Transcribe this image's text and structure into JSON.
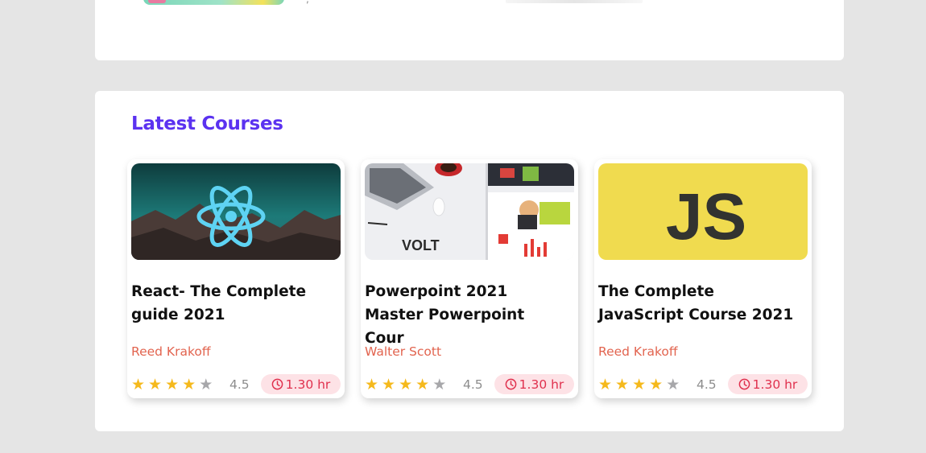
{
  "top": {
    "trailing_text": ","
  },
  "latest": {
    "title": "Latest Courses",
    "courses": [
      {
        "title": "React- The Complete guide 2021",
        "author": "Reed Krakoff",
        "rating": "4.5",
        "stars_filled": 4,
        "duration": "1.30 hr",
        "thumbnail": "react-logo-icon"
      },
      {
        "title": "Powerpoint 2021 Master Powerpoint Cour",
        "author": "Walter Scott",
        "rating": "4.5",
        "stars_filled": 4,
        "duration": "1.30 hr",
        "thumbnail": "powerpoint-volt-image",
        "thumbnail_text": "VOLT"
      },
      {
        "title": "The Complete JavaScript Course 2021",
        "author": "Reed Krakoff",
        "rating": "4.5",
        "stars_filled": 4,
        "duration": "1.30 hr",
        "thumbnail": "js-logo-icon",
        "thumbnail_text": "JS"
      }
    ]
  },
  "colors": {
    "page_bg": "#e5e5e5",
    "heading": "#5b32f0",
    "author": "#e2644f",
    "star_on": "#f5b91c",
    "star_off": "#a7a7aa",
    "duration_bg": "#fde2e6",
    "duration_text": "#e0314e",
    "js_bg": "#f0db4f"
  }
}
